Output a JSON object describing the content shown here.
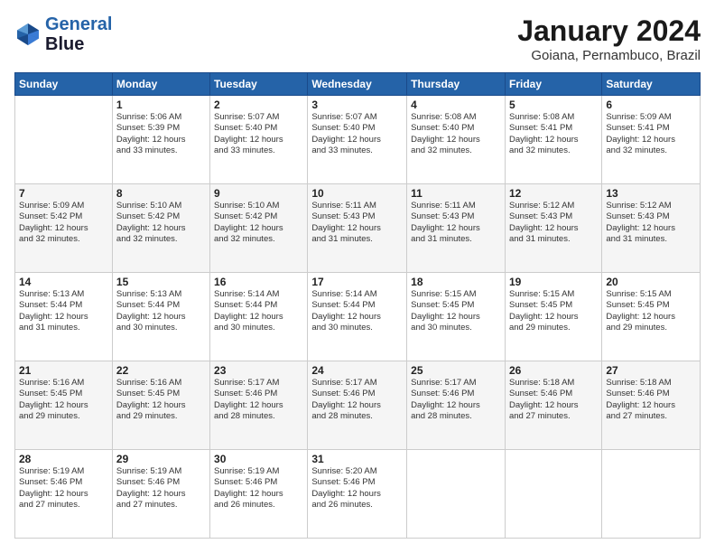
{
  "logo": {
    "line1": "General",
    "line2": "Blue"
  },
  "header": {
    "month": "January 2024",
    "location": "Goiana, Pernambuco, Brazil"
  },
  "weekdays": [
    "Sunday",
    "Monday",
    "Tuesday",
    "Wednesday",
    "Thursday",
    "Friday",
    "Saturday"
  ],
  "weeks": [
    [
      {
        "day": "",
        "info": ""
      },
      {
        "day": "1",
        "info": "Sunrise: 5:06 AM\nSunset: 5:39 PM\nDaylight: 12 hours\nand 33 minutes."
      },
      {
        "day": "2",
        "info": "Sunrise: 5:07 AM\nSunset: 5:40 PM\nDaylight: 12 hours\nand 33 minutes."
      },
      {
        "day": "3",
        "info": "Sunrise: 5:07 AM\nSunset: 5:40 PM\nDaylight: 12 hours\nand 33 minutes."
      },
      {
        "day": "4",
        "info": "Sunrise: 5:08 AM\nSunset: 5:40 PM\nDaylight: 12 hours\nand 32 minutes."
      },
      {
        "day": "5",
        "info": "Sunrise: 5:08 AM\nSunset: 5:41 PM\nDaylight: 12 hours\nand 32 minutes."
      },
      {
        "day": "6",
        "info": "Sunrise: 5:09 AM\nSunset: 5:41 PM\nDaylight: 12 hours\nand 32 minutes."
      }
    ],
    [
      {
        "day": "7",
        "info": "Sunrise: 5:09 AM\nSunset: 5:42 PM\nDaylight: 12 hours\nand 32 minutes."
      },
      {
        "day": "8",
        "info": "Sunrise: 5:10 AM\nSunset: 5:42 PM\nDaylight: 12 hours\nand 32 minutes."
      },
      {
        "day": "9",
        "info": "Sunrise: 5:10 AM\nSunset: 5:42 PM\nDaylight: 12 hours\nand 32 minutes."
      },
      {
        "day": "10",
        "info": "Sunrise: 5:11 AM\nSunset: 5:43 PM\nDaylight: 12 hours\nand 31 minutes."
      },
      {
        "day": "11",
        "info": "Sunrise: 5:11 AM\nSunset: 5:43 PM\nDaylight: 12 hours\nand 31 minutes."
      },
      {
        "day": "12",
        "info": "Sunrise: 5:12 AM\nSunset: 5:43 PM\nDaylight: 12 hours\nand 31 minutes."
      },
      {
        "day": "13",
        "info": "Sunrise: 5:12 AM\nSunset: 5:43 PM\nDaylight: 12 hours\nand 31 minutes."
      }
    ],
    [
      {
        "day": "14",
        "info": "Sunrise: 5:13 AM\nSunset: 5:44 PM\nDaylight: 12 hours\nand 31 minutes."
      },
      {
        "day": "15",
        "info": "Sunrise: 5:13 AM\nSunset: 5:44 PM\nDaylight: 12 hours\nand 30 minutes."
      },
      {
        "day": "16",
        "info": "Sunrise: 5:14 AM\nSunset: 5:44 PM\nDaylight: 12 hours\nand 30 minutes."
      },
      {
        "day": "17",
        "info": "Sunrise: 5:14 AM\nSunset: 5:44 PM\nDaylight: 12 hours\nand 30 minutes."
      },
      {
        "day": "18",
        "info": "Sunrise: 5:15 AM\nSunset: 5:45 PM\nDaylight: 12 hours\nand 30 minutes."
      },
      {
        "day": "19",
        "info": "Sunrise: 5:15 AM\nSunset: 5:45 PM\nDaylight: 12 hours\nand 29 minutes."
      },
      {
        "day": "20",
        "info": "Sunrise: 5:15 AM\nSunset: 5:45 PM\nDaylight: 12 hours\nand 29 minutes."
      }
    ],
    [
      {
        "day": "21",
        "info": "Sunrise: 5:16 AM\nSunset: 5:45 PM\nDaylight: 12 hours\nand 29 minutes."
      },
      {
        "day": "22",
        "info": "Sunrise: 5:16 AM\nSunset: 5:45 PM\nDaylight: 12 hours\nand 29 minutes."
      },
      {
        "day": "23",
        "info": "Sunrise: 5:17 AM\nSunset: 5:46 PM\nDaylight: 12 hours\nand 28 minutes."
      },
      {
        "day": "24",
        "info": "Sunrise: 5:17 AM\nSunset: 5:46 PM\nDaylight: 12 hours\nand 28 minutes."
      },
      {
        "day": "25",
        "info": "Sunrise: 5:17 AM\nSunset: 5:46 PM\nDaylight: 12 hours\nand 28 minutes."
      },
      {
        "day": "26",
        "info": "Sunrise: 5:18 AM\nSunset: 5:46 PM\nDaylight: 12 hours\nand 27 minutes."
      },
      {
        "day": "27",
        "info": "Sunrise: 5:18 AM\nSunset: 5:46 PM\nDaylight: 12 hours\nand 27 minutes."
      }
    ],
    [
      {
        "day": "28",
        "info": "Sunrise: 5:19 AM\nSunset: 5:46 PM\nDaylight: 12 hours\nand 27 minutes."
      },
      {
        "day": "29",
        "info": "Sunrise: 5:19 AM\nSunset: 5:46 PM\nDaylight: 12 hours\nand 27 minutes."
      },
      {
        "day": "30",
        "info": "Sunrise: 5:19 AM\nSunset: 5:46 PM\nDaylight: 12 hours\nand 26 minutes."
      },
      {
        "day": "31",
        "info": "Sunrise: 5:20 AM\nSunset: 5:46 PM\nDaylight: 12 hours\nand 26 minutes."
      },
      {
        "day": "",
        "info": ""
      },
      {
        "day": "",
        "info": ""
      },
      {
        "day": "",
        "info": ""
      }
    ]
  ]
}
